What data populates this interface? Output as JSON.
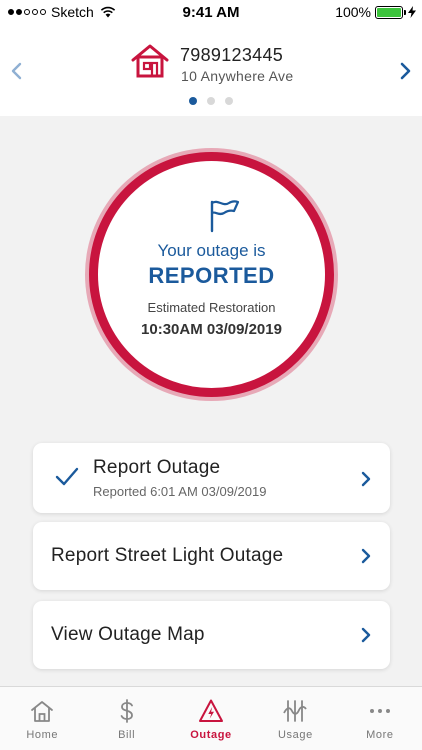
{
  "status_bar": {
    "carrier": "Sketch",
    "time": "9:41 AM",
    "battery": "100%"
  },
  "account": {
    "number": "7989123445",
    "address": "10 Anywhere Ave",
    "page_count": 3,
    "active_page": 1,
    "icon": "house-icon"
  },
  "outage_status": {
    "line": "Your outage is",
    "status": "REPORTED",
    "estimate_label": "Estimated Restoration",
    "estimate_time": "10:30AM 03/09/2019",
    "icon": "flag-icon"
  },
  "actions": [
    {
      "title": "Report Outage",
      "subtitle": "Reported 6:01 AM 03/09/2019",
      "completed": true
    },
    {
      "title": "Report Street Light Outage"
    },
    {
      "title": "View Outage Map"
    }
  ],
  "tabs": [
    {
      "label": "Home",
      "icon": "home-icon"
    },
    {
      "label": "Bill",
      "icon": "dollar-icon"
    },
    {
      "label": "Outage",
      "icon": "lightning-warning-icon",
      "active": true
    },
    {
      "label": "Usage",
      "icon": "usage-icon"
    },
    {
      "label": "More",
      "icon": "more-icon"
    }
  ],
  "colors": {
    "brand_red": "#c8143e",
    "brand_blue": "#1b5a9c",
    "battery_green": "#3cc43c"
  }
}
